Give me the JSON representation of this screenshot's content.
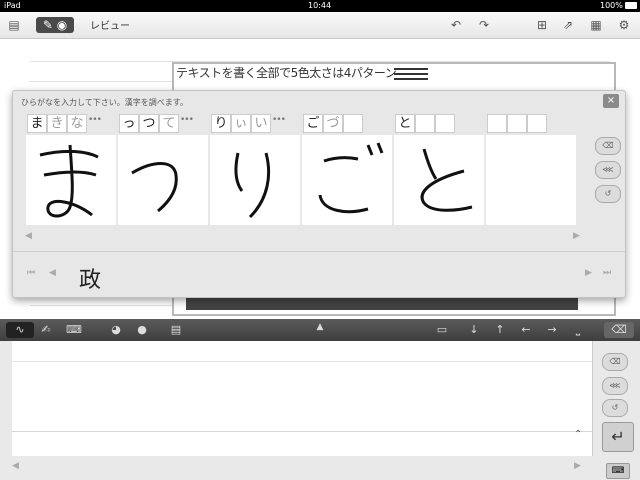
{
  "statusbar": {
    "device": "iPad",
    "time": "10:44",
    "battery": "100%"
  },
  "toolbar": {
    "title": "レビュー"
  },
  "document": {
    "note_text": "テキストを書く全部で5色太さは4パターン"
  },
  "popup": {
    "hint": "ひらがなを入力して下さい。漢字を調べます。",
    "close": "×",
    "candidates": [
      {
        "chars": [
          "ま",
          "き",
          "な"
        ],
        "more": "•••"
      },
      {
        "chars": [
          "っ",
          "つ",
          "て"
        ],
        "more": "•••"
      },
      {
        "chars": [
          "り",
          "ぃ",
          "い"
        ],
        "more": "•••"
      },
      {
        "chars": [
          "ご",
          "づ",
          ""
        ],
        "more": ""
      },
      {
        "chars": [
          "と",
          "",
          ""
        ],
        "more": ""
      },
      {
        "chars": [
          "",
          "",
          ""
        ],
        "more": ""
      }
    ],
    "handwriting": [
      "ま",
      "っ",
      "り",
      "ご",
      "と",
      ""
    ],
    "conversion": "政"
  },
  "enter_icon": "↵",
  "colors": {
    "accent": "#3c3c3c",
    "popup_bg": "#e7e7e7"
  }
}
